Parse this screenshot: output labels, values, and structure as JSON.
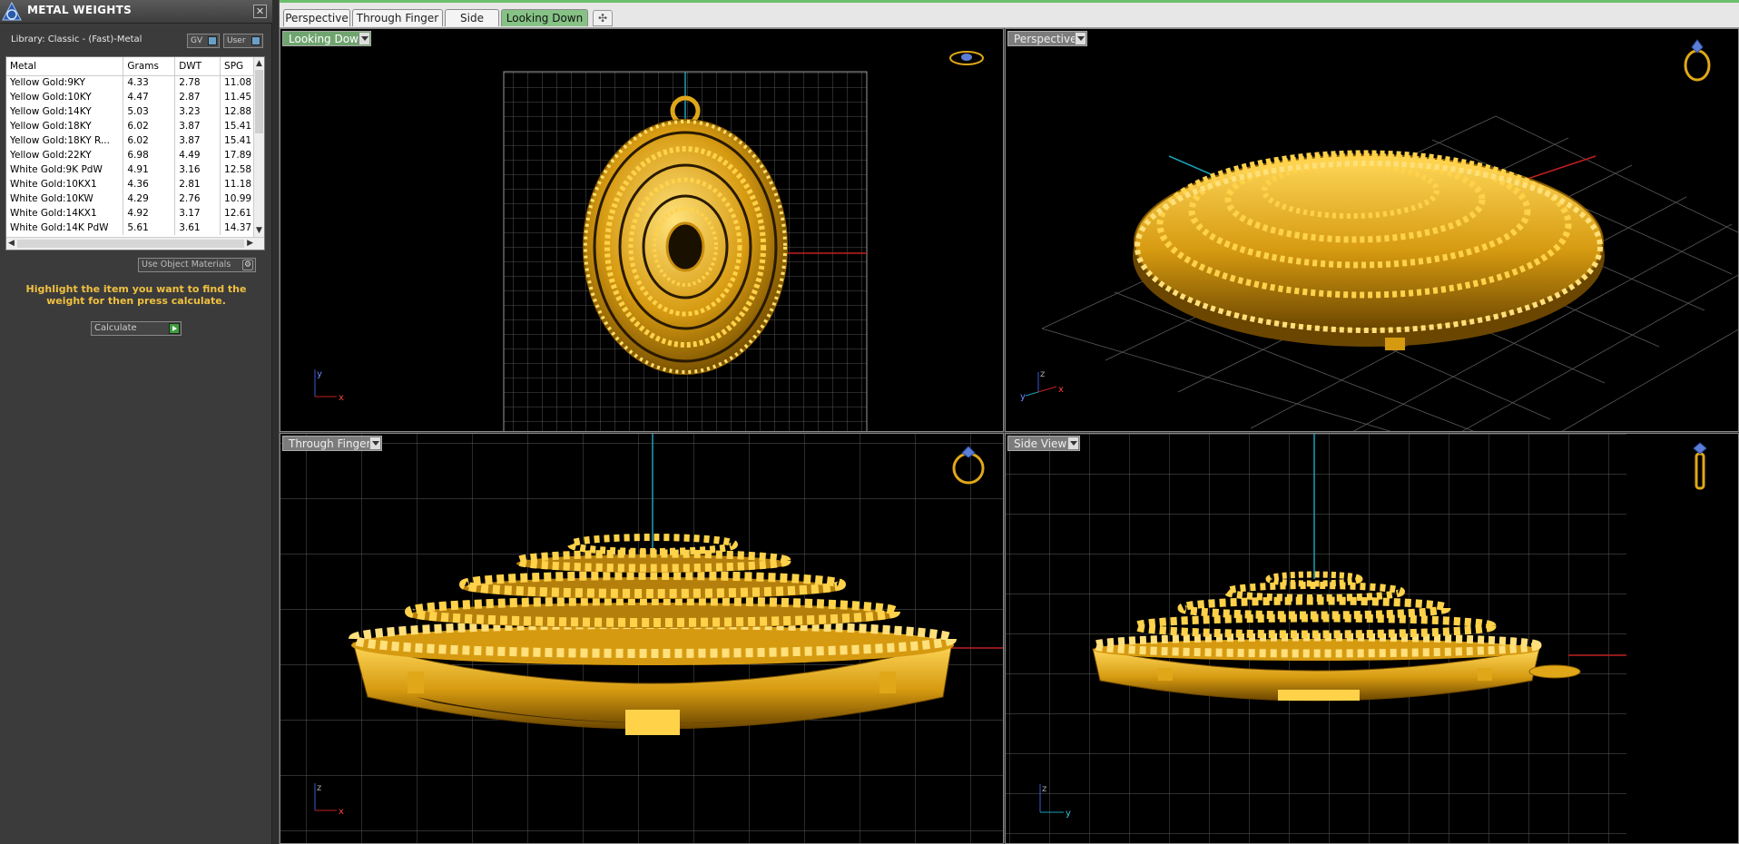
{
  "panel": {
    "title": "METAL WEIGHTS",
    "close_label": "✕",
    "library_label": "Library: Classic - (Fast)-Metal",
    "gv_label": "GV",
    "user_label": "User",
    "columns": [
      "Metal",
      "Grams",
      "DWT",
      "SPG"
    ],
    "rows": [
      {
        "metal": "Yellow Gold:9KY",
        "grams": "4.33",
        "dwt": "2.78",
        "spg": "11.08"
      },
      {
        "metal": "Yellow Gold:10KY",
        "grams": "4.47",
        "dwt": "2.87",
        "spg": "11.45"
      },
      {
        "metal": "Yellow Gold:14KY",
        "grams": "5.03",
        "dwt": "3.23",
        "spg": "12.88"
      },
      {
        "metal": "Yellow Gold:18KY",
        "grams": "6.02",
        "dwt": "3.87",
        "spg": "15.41"
      },
      {
        "metal": "Yellow Gold:18KY R...",
        "grams": "6.02",
        "dwt": "3.87",
        "spg": "15.41"
      },
      {
        "metal": "Yellow Gold:22KY",
        "grams": "6.98",
        "dwt": "4.49",
        "spg": "17.89"
      },
      {
        "metal": "White Gold:9K PdW",
        "grams": "4.91",
        "dwt": "3.16",
        "spg": "12.58"
      },
      {
        "metal": "White Gold:10KX1",
        "grams": "4.36",
        "dwt": "2.81",
        "spg": "11.18"
      },
      {
        "metal": "White Gold:10KW",
        "grams": "4.29",
        "dwt": "2.76",
        "spg": "10.99"
      },
      {
        "metal": "White Gold:14KX1",
        "grams": "4.92",
        "dwt": "3.17",
        "spg": "12.61"
      },
      {
        "metal": "White Gold:14K PdW",
        "grams": "5.61",
        "dwt": "3.61",
        "spg": "14.37"
      }
    ],
    "use_materials_label": "Use Object Materials",
    "instruction": "Highlight the item you want to find the weight for then press calculate.",
    "calculate_label": "Calculate"
  },
  "tabs": [
    "Perspective",
    "Through Finger",
    "Side View",
    "Looking Down"
  ],
  "active_tab": "Looking Down",
  "add_tab_label": "✣",
  "viewports": {
    "top_left": {
      "label": "Looking Down",
      "axis_a": "y",
      "axis_b": "x"
    },
    "top_right": {
      "label": "Perspective",
      "axis_a": "z",
      "axis_b": "y",
      "axis_c": "x"
    },
    "bottom_left": {
      "label": "Through Finger",
      "axis_a": "z",
      "axis_b": "x"
    },
    "bottom_right": {
      "label": "Side View",
      "axis_a": "z",
      "axis_b": "y"
    }
  },
  "colors": {
    "accent_green": "#6fa46f",
    "gold": "#e0a818",
    "highlight_text": "#f0c040"
  }
}
